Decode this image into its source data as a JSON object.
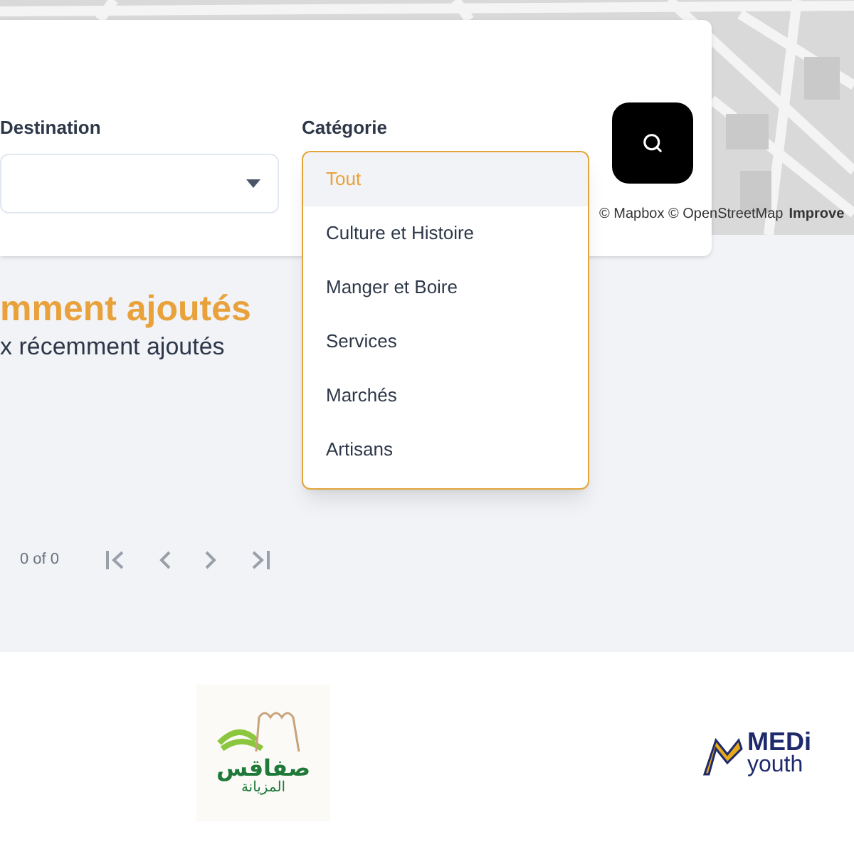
{
  "search_card": {
    "destination": {
      "label": "Destination"
    },
    "category": {
      "label": "Catégorie",
      "options": [
        {
          "label": "Tout",
          "selected": true
        },
        {
          "label": "Culture et Histoire",
          "selected": false
        },
        {
          "label": "Manger et Boire",
          "selected": false
        },
        {
          "label": "Services",
          "selected": false
        },
        {
          "label": "Marchés",
          "selected": false
        },
        {
          "label": "Artisans",
          "selected": false
        }
      ]
    }
  },
  "map_attribution": {
    "text": "© Mapbox © OpenStreetMap",
    "link": "Improve"
  },
  "section": {
    "title": "mment ajoutés",
    "subtitle": "x récemment ajoutés"
  },
  "pagination": {
    "count": "0 of 0"
  },
  "partners": [
    {
      "kind": "sfax",
      "name": "صفاقس",
      "tagline": "المزيانة"
    },
    {
      "kind": "medi",
      "name": "MEDi",
      "tagline": "youth"
    }
  ]
}
